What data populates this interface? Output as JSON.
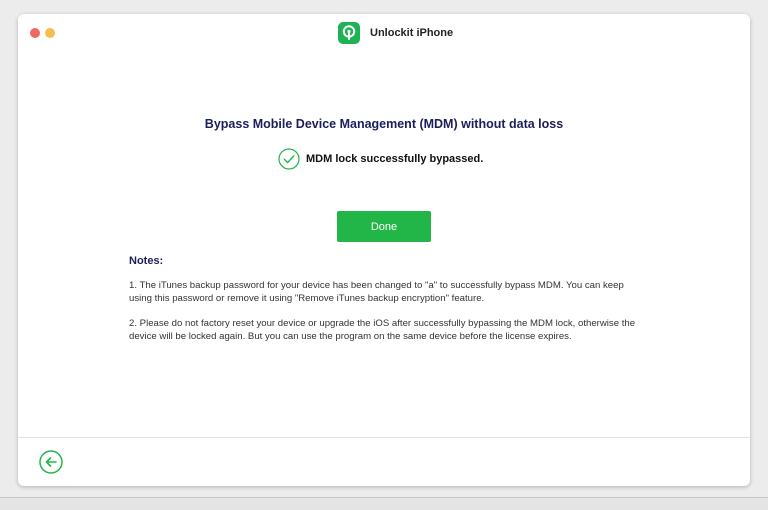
{
  "window": {
    "title": "Unlockit iPhone"
  },
  "main": {
    "heading": "Bypass Mobile Device Management (MDM) without data loss",
    "status_text": "MDM lock successfully bypassed.",
    "done_label": "Done",
    "notes_title": "Notes:",
    "note1": "1. The iTunes backup password for your device has been changed to \"a\" to successfully bypass MDM. You can keep using this password or remove it using \"Remove iTunes backup encryption\" feature.",
    "note2": "2. Please do not factory reset your device or upgrade the iOS after successfully bypassing the MDM lock, otherwise the device will be locked again. But you can use the program on the same device before the license expires."
  },
  "icons": {
    "logo": "lock-app-icon",
    "status": "checkmark-circle-icon",
    "back": "arrow-left-circle-icon"
  },
  "colors": {
    "accent": "#22b548",
    "heading": "#1a1f5a",
    "close": "#ed6a5e",
    "minimize": "#f5bf4f"
  }
}
